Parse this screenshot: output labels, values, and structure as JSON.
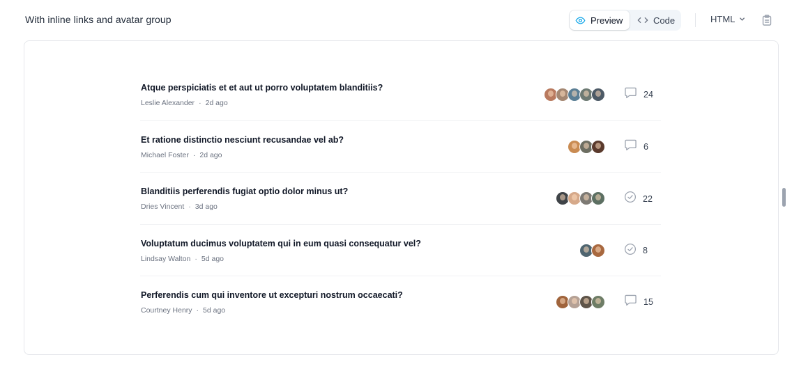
{
  "header": {
    "title": "With inline links and avatar group",
    "preview_label": "Preview",
    "code_label": "Code",
    "language": "HTML",
    "icons": {
      "preview": "eye-icon",
      "code": "code-brackets-icon",
      "dropdown": "chevron-down-icon",
      "copy": "clipboard-icon"
    }
  },
  "colors": {
    "accent": "#0ea5e9",
    "status_icon": "#9ca3af"
  },
  "discussions": [
    {
      "title": "Atque perspiciatis et et aut ut porro voluptatem blanditiis?",
      "author": "Leslie Alexander",
      "separator": "·",
      "time": "2d ago",
      "status_icon": "chat-bubble-icon",
      "count": "24",
      "avatars": [
        "#b97a5f",
        "#a48772",
        "#5b7f95",
        "#6d7a73",
        "#4d5a66"
      ]
    },
    {
      "title": "Et ratione distinctio nesciunt recusandae vel ab?",
      "author": "Michael Foster",
      "separator": "·",
      "time": "2d ago",
      "status_icon": "chat-bubble-icon",
      "count": "6",
      "avatars": [
        "#c98b52",
        "#6d6e62",
        "#5a3a2c"
      ]
    },
    {
      "title": "Blanditiis perferendis fugiat optio dolor minus ut?",
      "author": "Dries Vincent",
      "separator": "·",
      "time": "3d ago",
      "status_icon": "check-circle-icon",
      "count": "22",
      "avatars": [
        "#3f4448",
        "#d6a98a",
        "#7d7a74",
        "#5c6f62"
      ]
    },
    {
      "title": "Voluptatum ducimus voluptatem qui in eum quasi consequatur vel?",
      "author": "Lindsay Walton",
      "separator": "·",
      "time": "5d ago",
      "status_icon": "check-circle-icon",
      "count": "8",
      "avatars": [
        "#4f6570",
        "#a8683f"
      ]
    },
    {
      "title": "Perferendis cum qui inventore ut excepturi nostrum occaecati?",
      "author": "Courtney Henry",
      "separator": "·",
      "time": "5d ago",
      "status_icon": "chat-bubble-icon",
      "count": "15",
      "avatars": [
        "#a0643c",
        "#b5a195",
        "#5e5449",
        "#6e7d66"
      ]
    }
  ]
}
